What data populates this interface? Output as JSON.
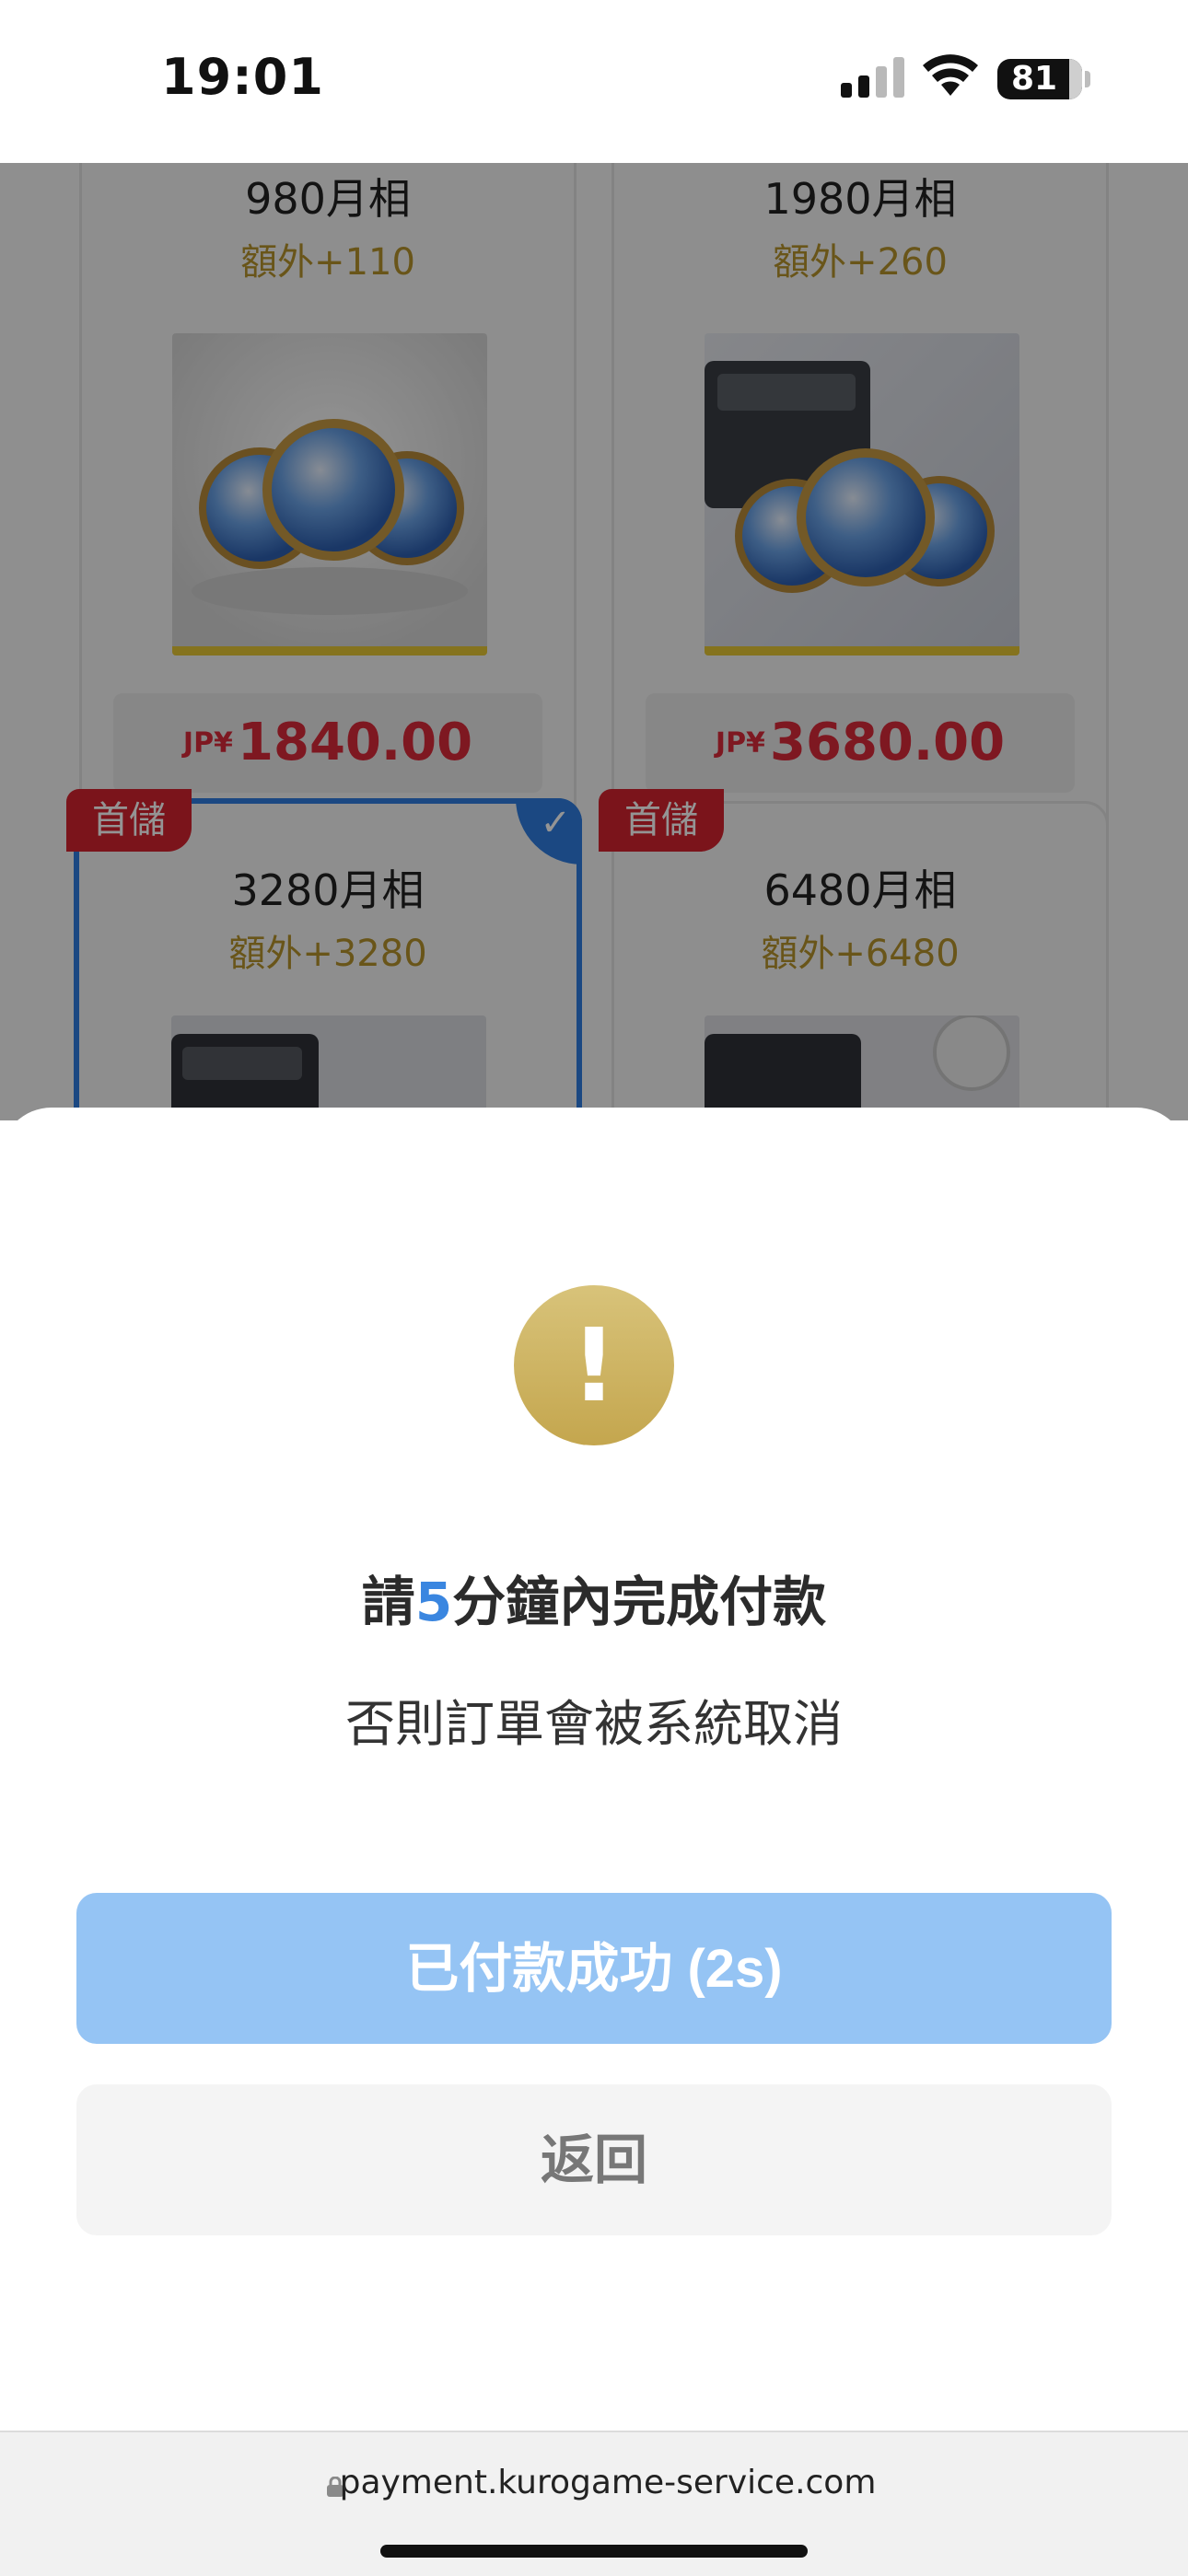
{
  "status_bar": {
    "time": "19:01",
    "battery_level": "81"
  },
  "background_page": {
    "cards": [
      {
        "title": "980月相",
        "bonus": "額外+110",
        "currency": "JP¥",
        "price": "1840.00",
        "badge": "",
        "selected": false
      },
      {
        "title": "1980月相",
        "bonus": "額外+260",
        "currency": "JP¥",
        "price": "3680.00",
        "badge": "",
        "selected": false
      },
      {
        "title": "3280月相",
        "bonus": "額外+3280",
        "currency": "",
        "price": "",
        "badge": "首儲",
        "selected": true
      },
      {
        "title": "6480月相",
        "bonus": "額外+6480",
        "currency": "",
        "price": "",
        "badge": "首儲",
        "selected": false
      }
    ]
  },
  "dialog": {
    "icon": "exclamation-icon",
    "title_prefix": "請",
    "title_number": "5",
    "title_suffix": "分鐘內完成付款",
    "subtitle": "否則訂單會被系統取消",
    "primary_button": "已付款成功 (2s)",
    "secondary_button": "返回"
  },
  "browser": {
    "url": "payment.kurogame-service.com"
  },
  "colors": {
    "accent_blue": "#2f7de1",
    "primary_button_bg": "#95c4f4",
    "price_red": "#d92a3a",
    "bonus_gold": "#b6932c",
    "alert_gold": "#c4a64e",
    "badge_red": "#d5232f"
  }
}
